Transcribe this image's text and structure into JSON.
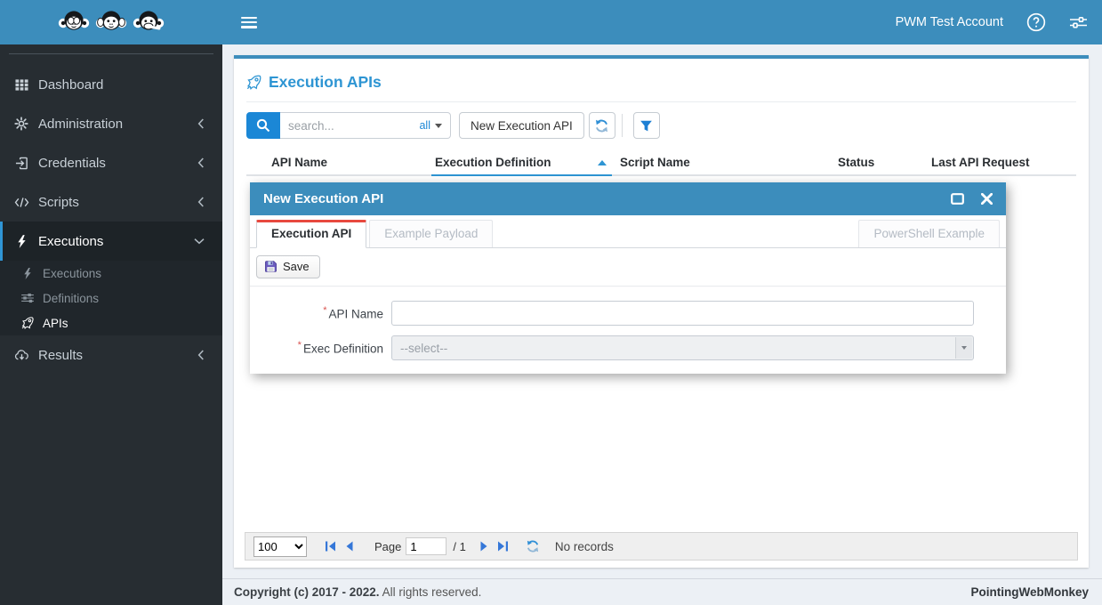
{
  "colors": {
    "topbar_blue": "#3c8dbc",
    "accent_blue": "#2e95d3",
    "search_button_blue": "#1b87d6",
    "sidebar_bg": "#272d32",
    "submenu_bg": "#20262b",
    "active_tab_red": "#e8493f",
    "required_red": "#d9534f"
  },
  "topbar": {
    "account_name": "PWM Test Account",
    "icons": [
      "hamburger-icon",
      "help-circle-icon",
      "sliders-icon"
    ]
  },
  "sidebar": {
    "logo_icon": "three-wise-monkeys",
    "items": [
      {
        "label": "Dashboard",
        "icon": "grid-icon",
        "chevron": null,
        "active": false
      },
      {
        "label": "Administration",
        "icon": "gears-icon",
        "chevron": "left",
        "active": false
      },
      {
        "label": "Credentials",
        "icon": "sign-in-icon",
        "chevron": "left",
        "active": false
      },
      {
        "label": "Scripts",
        "icon": "code-icon",
        "chevron": "left",
        "active": false
      },
      {
        "label": "Executions",
        "icon": "bolt-icon",
        "chevron": "down",
        "active": true
      },
      {
        "label": "Results",
        "icon": "cloud-download-icon",
        "chevron": "left",
        "active": false
      }
    ],
    "executions_submenu": [
      {
        "label": "Executions",
        "icon": "bolt-icon",
        "active": false
      },
      {
        "label": "Definitions",
        "icon": "sliders-icon",
        "active": false
      },
      {
        "label": "APIs",
        "icon": "rocket-icon",
        "active": true
      }
    ]
  },
  "main": {
    "title": "Execution APIs",
    "title_icon": "rocket-icon",
    "search": {
      "placeholder": "search...",
      "scope": "all"
    },
    "new_api_button": "New Execution API",
    "table": {
      "headers": [
        "API Name",
        "Execution Definition",
        "Script Name",
        "Status",
        "Last API Request"
      ],
      "sorted_by": "Execution Definition",
      "sort_direction": "asc",
      "rows": []
    }
  },
  "modal": {
    "title": "New Execution API",
    "tabs": [
      {
        "label": "Execution API",
        "active": true
      },
      {
        "label": "Example Payload",
        "active": false
      },
      {
        "label": "PowerShell Example",
        "active": false
      }
    ],
    "save_button": "Save",
    "required_marker": "*",
    "fields": {
      "api_name": {
        "label": "API Name",
        "required": true,
        "value": ""
      },
      "exec_definition": {
        "label": "Exec Definition",
        "required": true,
        "value": "--select--"
      }
    }
  },
  "pager": {
    "page_size": "100",
    "page_label": "Page",
    "page_value": "1",
    "total": "/ 1",
    "status": "No records"
  },
  "footer": {
    "copyright_strong": "Copyright (c) 2017 - 2022.",
    "copyright_text": " All rights reserved.",
    "brand": "PointingWebMonkey"
  }
}
